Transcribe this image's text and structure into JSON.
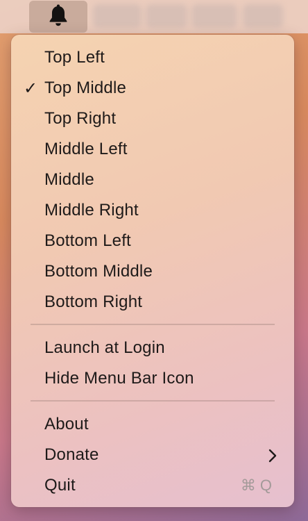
{
  "menubar": {
    "bell_icon": "bell-icon"
  },
  "menu": {
    "position_items": [
      {
        "label": "Top Left",
        "checked": false
      },
      {
        "label": "Top Middle",
        "checked": true
      },
      {
        "label": "Top Right",
        "checked": false
      },
      {
        "label": "Middle Left",
        "checked": false
      },
      {
        "label": "Middle",
        "checked": false
      },
      {
        "label": "Middle Right",
        "checked": false
      },
      {
        "label": "Bottom Left",
        "checked": false
      },
      {
        "label": "Bottom Middle",
        "checked": false
      },
      {
        "label": "Bottom Right",
        "checked": false
      }
    ],
    "check_mark": "✓",
    "launch_at_login": "Launch at Login",
    "hide_menu_bar_icon": "Hide Menu Bar Icon",
    "about": "About",
    "donate": "Donate",
    "quit": "Quit",
    "quit_shortcut": "⌘Q"
  },
  "colors": {
    "text": "#1e1a19",
    "shortcut": "#a39a99"
  }
}
